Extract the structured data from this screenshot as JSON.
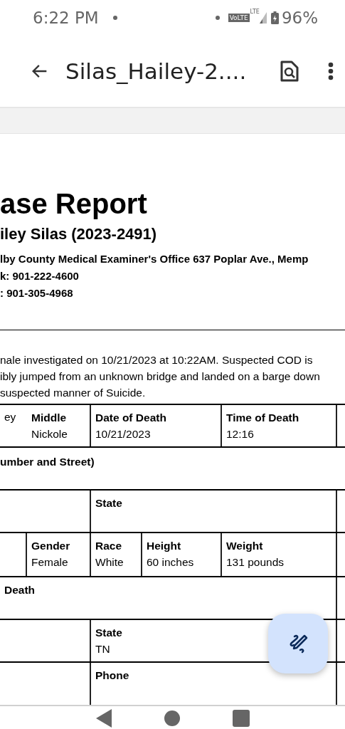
{
  "status_bar": {
    "time": "6:22 PM",
    "volte": "VoLTE",
    "network": "LTE",
    "battery": "96%"
  },
  "app_bar": {
    "title": "Silas_Hailey-2...."
  },
  "document": {
    "title": "ase Report",
    "subtitle": "iley Silas (2023-2491)",
    "header_lines": [
      "lby County Medical Examiner's Office 637 Poplar Ave., Memp",
      "k: 901-222-4600",
      ": 901-305-4968"
    ],
    "summary": [
      "nale investigated on 10/21/2023 at 10:22AM. Suspected COD is",
      "ibly jumped from an unknown bridge and landed on a barge down",
      "suspected manner of Suicide."
    ],
    "table": {
      "rows": [
        {
          "kind": "grid",
          "cells": [
            {
              "value": "ey"
            },
            {
              "label": "Middle",
              "value": "Nickole"
            },
            {
              "label": "Date of Death",
              "value": "10/21/2023",
              "colspan": 2
            },
            {
              "label": "Time of Death",
              "value": "12:16"
            }
          ]
        },
        {
          "kind": "label",
          "cells": [
            {
              "label": "umber and Street)"
            }
          ]
        },
        {
          "kind": "grid",
          "cells": [
            "",
            "",
            {
              "label": "State",
              "colspan": 3
            }
          ]
        },
        {
          "kind": "grid",
          "cells": [
            "",
            {
              "label": "Gender",
              "value": "Female"
            },
            {
              "label": "Race",
              "value": "White"
            },
            {
              "label": "Height",
              "value": "60 inches"
            },
            {
              "label": "Weight",
              "value": "131 pounds"
            }
          ]
        },
        {
          "kind": "grid",
          "cells": [
            {
              "label": "Death",
              "colspan": 5
            }
          ]
        },
        {
          "kind": "grid",
          "cells": [
            "",
            "",
            {
              "label": "State",
              "value": "TN",
              "colspan": 3
            }
          ]
        },
        {
          "kind": "grid",
          "cells": [
            "",
            "",
            {
              "label": "Phone",
              "colspan": 3
            }
          ]
        }
      ]
    }
  }
}
